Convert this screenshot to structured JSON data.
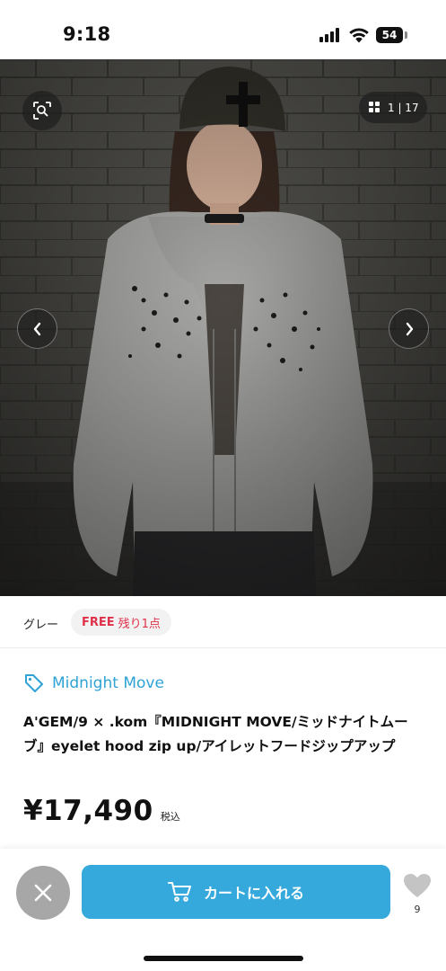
{
  "status_bar": {
    "time": "9:18",
    "battery": "54",
    "icons": [
      "cellular-signal-icon",
      "wifi-icon",
      "battery-icon"
    ]
  },
  "gallery": {
    "counter": "1 | 17",
    "icons": [
      "image-search-icon",
      "grid-icon",
      "chevron-left-icon",
      "chevron-right-icon"
    ]
  },
  "variant": {
    "color": "グレー",
    "size": "FREE",
    "stock": "残り1点"
  },
  "brand": {
    "name": "Midnight Move",
    "icon": "tag-icon"
  },
  "product": {
    "title": "A'GEM/9 × .kom『MIDNIGHT MOVE/ミッドナイトムーブ』eyelet hood zip up/アイレットフードジップアップ",
    "price": "¥17,490",
    "tax_label": "税込"
  },
  "actions": {
    "cart_label": "カートに入れる",
    "favorite_count": "9",
    "icons": [
      "close-icon",
      "cart-icon",
      "heart-icon"
    ]
  },
  "colors": {
    "accent": "#35a8dc",
    "brand_text": "#2fa3d6",
    "stock_red": "#e0314b",
    "close_gray": "#a7a7a7"
  }
}
